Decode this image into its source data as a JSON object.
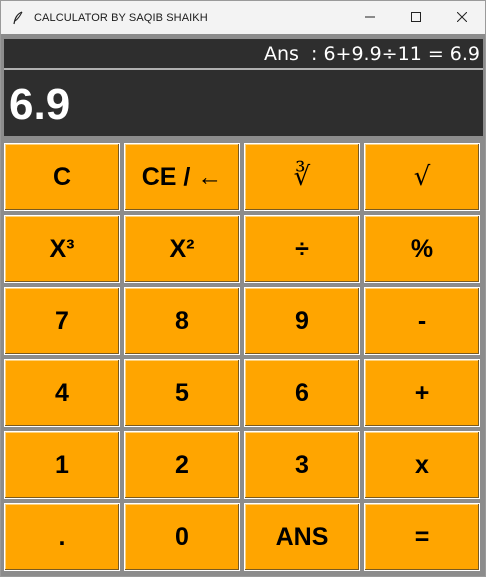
{
  "window": {
    "title": "CALCULATOR BY SAQIB SHAIKH",
    "app_icon": "feather-icon",
    "controls": [
      "minimize-icon",
      "maximize-icon",
      "close-icon"
    ]
  },
  "display": {
    "history": "Ans  : 6+9.9÷11 = 6.9",
    "result": "6.9"
  },
  "keys": {
    "clear": "C",
    "clear_entry": "CE / ←",
    "cube_root": "∛",
    "square_root": "√",
    "cube": "X³",
    "square": "X²",
    "divide": "÷",
    "percent": "%",
    "seven": "7",
    "eight": "8",
    "nine": "9",
    "minus": "-",
    "four": "4",
    "five": "5",
    "six": "6",
    "plus": "+",
    "one": "1",
    "two": "2",
    "three": "3",
    "multiply": "x",
    "decimal": ".",
    "zero": "0",
    "ans": "ANS",
    "equals": "="
  },
  "colors": {
    "key_bg": "#ffa500",
    "display_bg": "#2e2e2e",
    "frame_bg": "#8c8c8c"
  }
}
